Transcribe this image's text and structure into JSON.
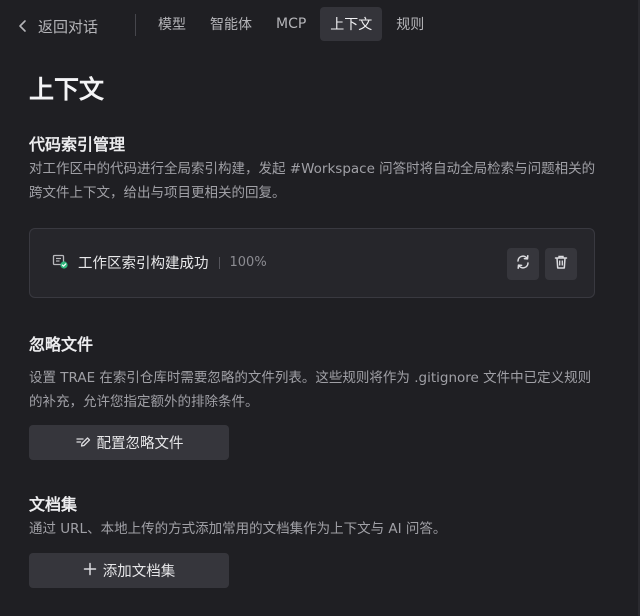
{
  "nav": {
    "back_label": "返回对话",
    "tabs": [
      {
        "label": "模型",
        "active": false
      },
      {
        "label": "智能体",
        "active": false
      },
      {
        "label": "MCP",
        "active": false
      },
      {
        "label": "上下文",
        "active": true
      },
      {
        "label": "规则",
        "active": false
      }
    ]
  },
  "page": {
    "title": "上下文"
  },
  "code_index": {
    "title": "代码索引管理",
    "description": "对工作区中的代码进行全局索引构建，发起 #Workspace 问答时将自动全局检索与问题相关的跨文件上下文，给出与项目更相关的回复。",
    "status_text": "工作区索引构建成功",
    "progress_text": "100%",
    "progress": 1.0,
    "refresh_icon": "refresh-icon",
    "delete_icon": "trash-icon"
  },
  "ignore_files": {
    "title": "忽略文件",
    "description": "设置 TRAE 在索引仓库时需要忽略的文件列表。这些规则将作为 .gitignore 文件中已定义规则的补充，允许您指定额外的排除条件。",
    "button_label": "配置忽略文件",
    "button_icon": "edit-icon"
  },
  "docs": {
    "title": "文档集",
    "description": "通过 URL、本地上传的方式添加常用的文档集作为上下文与 AI 问答。",
    "button_label": "添加文档集",
    "button_icon": "plus-icon"
  },
  "colors": {
    "background": "#1f1f23",
    "card": "#26262b",
    "button": "#36363c",
    "success": "#2fb67c"
  }
}
